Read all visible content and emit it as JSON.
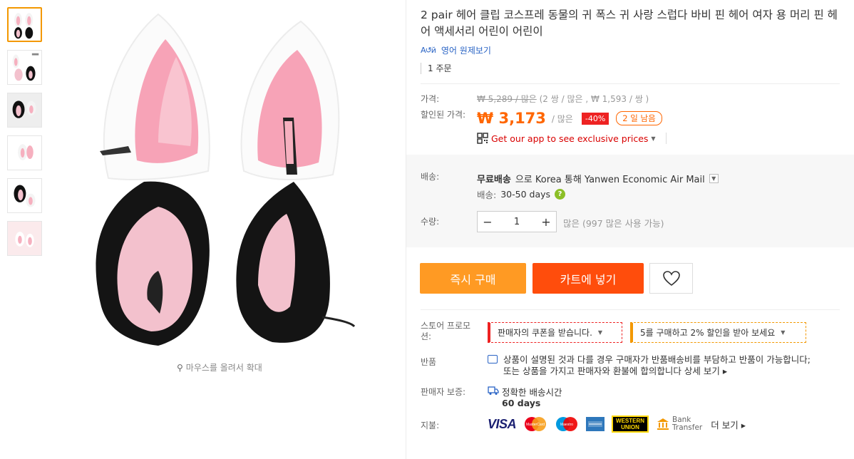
{
  "product": {
    "title": "2 pair 헤어 클립 코스프레 동물의 귀 폭스 귀 사랑 스럽다 바비 핀 헤어 여자 용 머리 핀 헤어 액세서리 어린이 어린이",
    "translate_label": "영어 원제보기",
    "translate_icon_text": "A↺й",
    "orders": "1 주문",
    "zoom_hint": "마우스를 올려서 확대"
  },
  "price": {
    "price_label": "가격:",
    "original": "₩ 5,289 / 많은",
    "original_per": "(2 쌍 / 많은 , ₩ 1,593 / 쌍 )",
    "discount_label": "할인된 가격:",
    "discounted": "₩ 3,173",
    "discounted_unit": "/ 많은",
    "discount_pct": "-40%",
    "days_left": "2 일 남음",
    "app_promo": "Get our app to see exclusive prices"
  },
  "shipping": {
    "label": "배송:",
    "free": "무료배송",
    "to_text": "으로 Korea 통해 Yanwen Economic Air Mail",
    "days_label": "배송:",
    "days_value": "30-50 days"
  },
  "quantity": {
    "label": "수량:",
    "value": "1",
    "minus": "−",
    "plus": "+",
    "note": "많은 (997 많은 사용 가능)"
  },
  "actions": {
    "buy_now": "즉시 구매",
    "add_to_cart": "카트에 넣기"
  },
  "promotion": {
    "label": "스토어 프로모션:",
    "coupon": "판매자의 쿠폰을 받습니다.",
    "bulk": "5를 구매하고 2% 할인을 받아 보세요"
  },
  "returns": {
    "label": "반품",
    "text": "상품이 설명된 것과 다를 경우 구매자가 반품배송비를 부담하고 반품이 가능합니다; 또는 상품을 가지고 판매자와 환불에 합의합니다",
    "more": "상세 보기"
  },
  "guarantee": {
    "label": "판매자 보증:",
    "text": "정확한 배송시간",
    "days": "60 days"
  },
  "payment": {
    "label": "지불:",
    "visa": "VISA",
    "mastercard": "MasterCard",
    "maestro": "Maestro",
    "western_union_1": "WESTERN",
    "western_union_2": "UNION",
    "bank_1": "Bank",
    "bank_2": "Transfer",
    "more": "더 보기"
  },
  "colors": {
    "accent_orange": "#ff9a23",
    "cart_red": "#ff4d0c",
    "price_orange": "#ff6600",
    "link_blue": "#2a64c5"
  }
}
